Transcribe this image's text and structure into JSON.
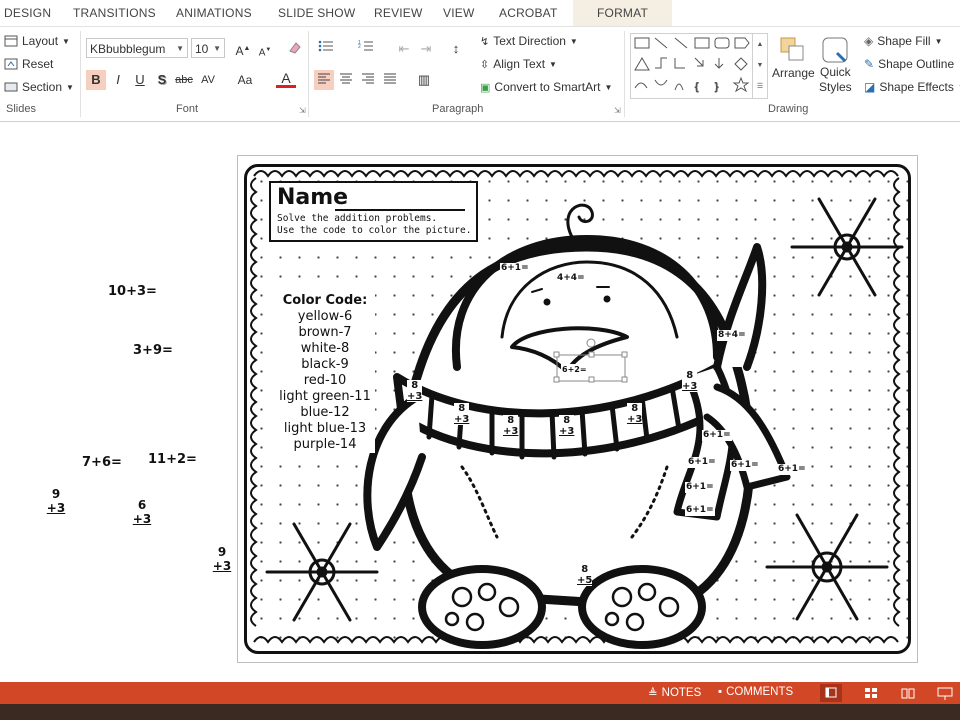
{
  "tabs": [
    "DESIGN",
    "TRANSITIONS",
    "ANIMATIONS",
    "SLIDE SHOW",
    "REVIEW",
    "VIEW",
    "ACROBAT",
    "FORMAT"
  ],
  "slides_group": {
    "layout": "Layout",
    "reset": "Reset",
    "section": "Section",
    "label": "Slides"
  },
  "font_group": {
    "font_name": "KBbubblegum",
    "font_size": "10",
    "label": "Font",
    "bold": "B",
    "italic": "I",
    "underline": "U",
    "shadow": "S",
    "strike": "abc",
    "spacing": "AV",
    "case": "Aa",
    "color": "A"
  },
  "paragraph_group": {
    "text_direction": "Text Direction",
    "align_text": "Align Text",
    "convert_smartart": "Convert to SmartArt",
    "label": "Paragraph"
  },
  "drawing_group": {
    "arrange": "Arrange",
    "quick_styles_1": "Quick",
    "quick_styles_2": "Styles",
    "shape_fill": "Shape Fill",
    "shape_outline": "Shape Outline",
    "shape_effects": "Shape Effects",
    "label": "Drawing"
  },
  "worksheet": {
    "name_label": "Name",
    "instruction_1": "Solve the addition problems.",
    "instruction_2": "Use the code to color the picture.",
    "code_title": "Color Code:",
    "code_items": [
      "yellow-6",
      "brown-7",
      "white-8",
      "black-9",
      "red-10",
      "light green-11",
      "blue-12",
      "light blue-13",
      "purple-14"
    ]
  },
  "side_problems": {
    "p1": "10+3=",
    "p2": "3+9=",
    "p3": "7+6=",
    "p4": "11+2=",
    "p5_top": "9",
    "p5_bot": "+3",
    "p6_top": "6",
    "p6_bot": "+3",
    "p7_top": "9",
    "p7_bot": "+3"
  },
  "picture_problems": {
    "a": "6+1=",
    "b": "4+4=",
    "c": "8+4=",
    "sel": "6+2=",
    "v8": "8",
    "p3": "+3",
    "p5": "+5",
    "s1": "6+1=",
    "s2": "6+1=",
    "s3": "6+1=",
    "s4": "6+1=",
    "s5": "6+1=",
    "s6": "6+1="
  },
  "status": {
    "notes": "NOTES",
    "comments": "COMMENTS"
  },
  "colors": {
    "accent": "#d24726",
    "format_tab": "#f4efe2",
    "pressed": "#f7cfc0"
  }
}
